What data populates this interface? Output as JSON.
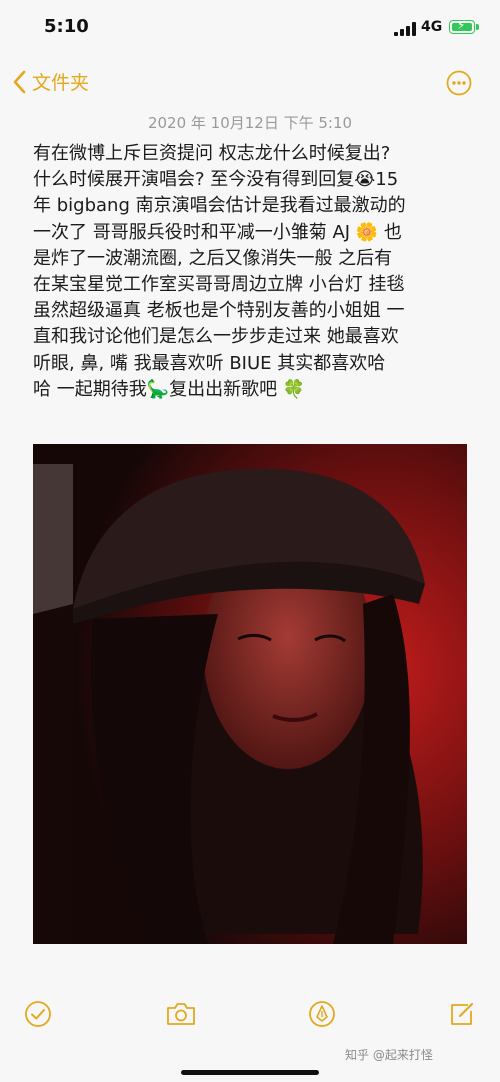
{
  "status_bar": {
    "time": "5:10",
    "network": "4G"
  },
  "nav": {
    "back_label": "文件夹"
  },
  "note": {
    "date": "2020 年 10月12日  下午 5:10",
    "lines": [
      "有在微博上斥巨资提问 权志龙什么时候复出?",
      "什么时候展开演唱会? 至今没有得到回复😭15",
      "年 bigbang 南京演唱会估计是我看过最激动的",
      "一次了  哥哥服兵役时和平减一小雏菊 AJ 🌼 也",
      "是炸了一波潮流圈, 之后又像消失一般 之后有",
      "在某宝星觉工作室买哥哥周边立牌 小台灯 挂毯",
      "虽然超级逼真  老板也是个特别友善的小姐姐 一",
      "直和我讨论他们是怎么一步步走过来  她最喜欢",
      "听眼, 鼻, 嘴 我最喜欢听 BIUE  其实都喜欢哈",
      "哈  一起期待我🦕复出出新歌吧 🍀"
    ]
  },
  "watermark": "知乎 @起来打怪",
  "colors": {
    "accent": "#e3a81e",
    "battery": "#34c759",
    "photo_tint": "#b01a1a"
  },
  "icons": {
    "back": "chevron-left-icon",
    "more": "ellipsis-circle-icon",
    "checklist": "checkmark-circle-icon",
    "camera": "camera-icon",
    "markup": "pen-tip-circle-icon",
    "compose": "compose-icon"
  }
}
